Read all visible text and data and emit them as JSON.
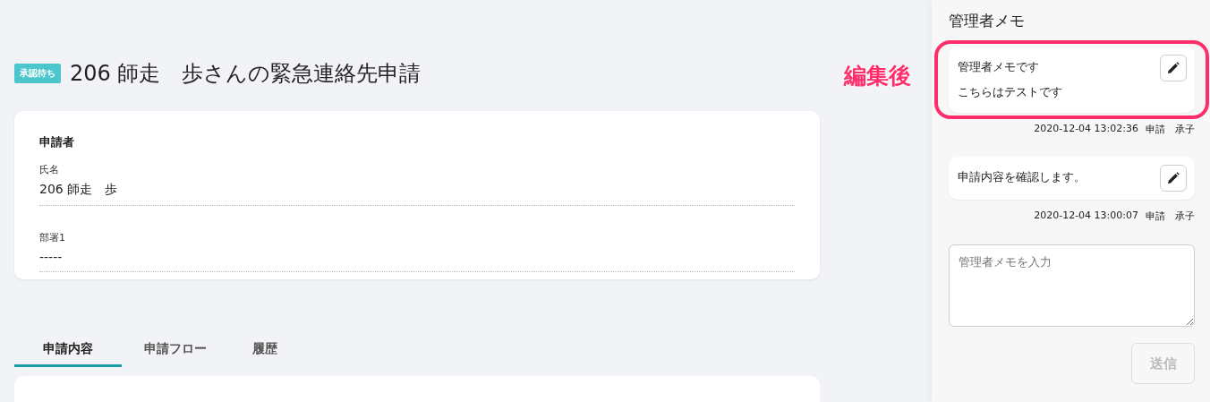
{
  "header": {
    "status_badge": "承認待ち",
    "title": "206 師走　歩さんの緊急連絡先申請"
  },
  "applicant_card": {
    "heading": "申請者",
    "fields": [
      {
        "label": "氏名",
        "value": "206 師走　歩"
      },
      {
        "label": "部署1",
        "value": "-----"
      }
    ]
  },
  "tabs": [
    {
      "label": "申請内容",
      "selected": true
    },
    {
      "label": "申請フロー",
      "selected": false
    },
    {
      "label": "履歴",
      "selected": false
    }
  ],
  "annotation": {
    "label": "編集後"
  },
  "memo_panel": {
    "title": "管理者メモ",
    "memos": [
      {
        "lines": [
          "管理者メモです",
          "こちらはテストです"
        ],
        "timestamp": "2020-12-04 13:02:36",
        "author": "申請　承子",
        "highlighted": true
      },
      {
        "lines": [
          "申請内容を確認します。"
        ],
        "timestamp": "2020-12-04 13:00:07",
        "author": "申請　承子",
        "highlighted": false
      }
    ],
    "input": {
      "placeholder": "管理者メモを入力"
    },
    "send_button": {
      "label": "送信",
      "disabled": true
    }
  }
}
